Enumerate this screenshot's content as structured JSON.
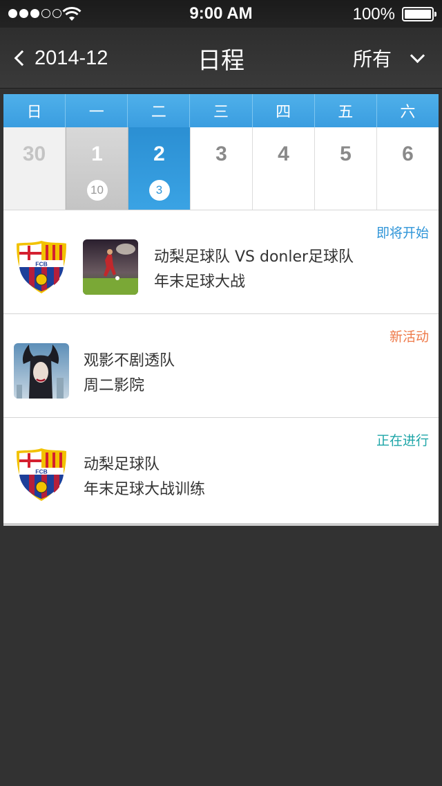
{
  "status_bar": {
    "time": "9:00 AM",
    "battery": "100%"
  },
  "nav": {
    "back_icon": "chevron-left-icon",
    "month": "2014-12",
    "title": "日程",
    "filter_label": "所有",
    "filter_icon": "chevron-down-icon"
  },
  "calendar": {
    "weekdays": [
      "日",
      "一",
      "二",
      "三",
      "四",
      "五",
      "六"
    ],
    "days": [
      {
        "num": "30",
        "badge": ""
      },
      {
        "num": "1",
        "badge": "10"
      },
      {
        "num": "2",
        "badge": "3"
      },
      {
        "num": "3",
        "badge": ""
      },
      {
        "num": "4",
        "badge": ""
      },
      {
        "num": "5",
        "badge": ""
      },
      {
        "num": "6",
        "badge": ""
      }
    ]
  },
  "events": [
    {
      "status": "即将开始",
      "line1": "动梨足球队 VS donler足球队",
      "line2": "年末足球大战"
    },
    {
      "status": "新活动",
      "line1": "观影不剧透队",
      "line2": "周二影院"
    },
    {
      "status": "正在进行",
      "line1": "动梨足球队",
      "line2": "年末足球大战训练"
    }
  ],
  "colors": {
    "accent_blue": "#2f95d8",
    "status_orange": "#ee7a4a",
    "status_teal": "#1ea6a8"
  }
}
